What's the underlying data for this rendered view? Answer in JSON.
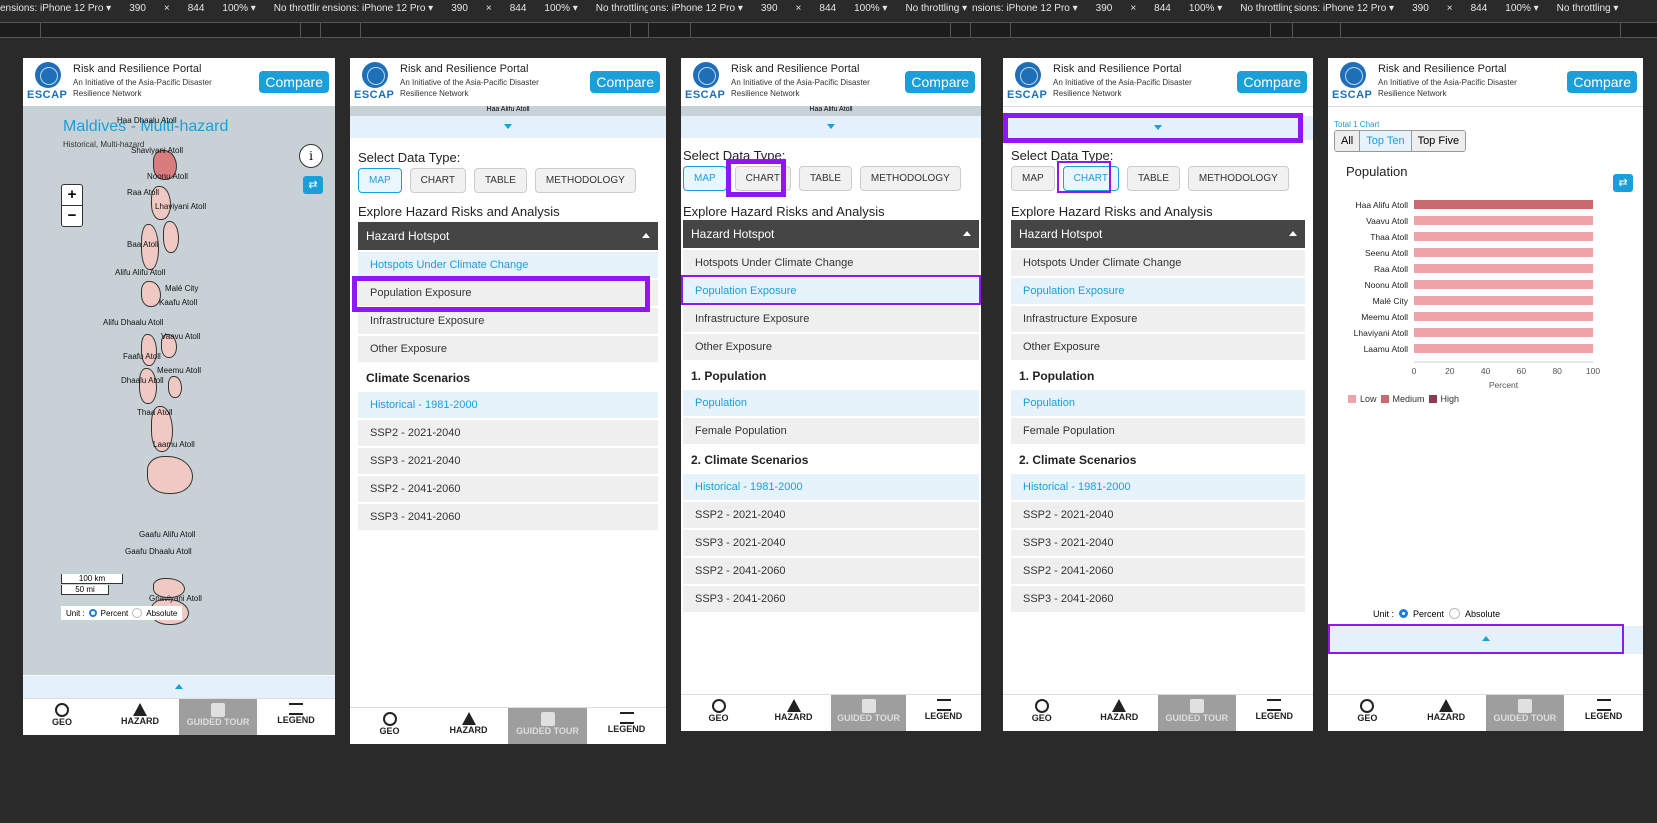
{
  "devtools": {
    "panes": [
      {
        "text": "ensions: iPhone 12 Pro ▾",
        "w": "390",
        "x": "×",
        "h": "844",
        "zoom": "100% ▾",
        "throttle": "No throttling ▾"
      },
      {
        "text": "ensions: iPhone 12 Pro ▾",
        "w": "390",
        "x": "×",
        "h": "844",
        "zoom": "100% ▾",
        "throttle": "No throttling ▾"
      },
      {
        "text": "ons: iPhone 12 Pro ▾",
        "w": "390",
        "x": "×",
        "h": "844",
        "zoom": "100% ▾",
        "throttle": "No throttling ▾"
      },
      {
        "text": "nsions: iPhone 12 Pro ▾",
        "w": "390",
        "x": "×",
        "h": "844",
        "zoom": "100% ▾",
        "throttle": "No throttling ▾"
      },
      {
        "text": "sions: iPhone 12 Pro ▾",
        "w": "390",
        "x": "×",
        "h": "844",
        "zoom": "100% ▾",
        "throttle": "No throttling ▾"
      }
    ]
  },
  "header": {
    "title": "Risk and Resilience Portal",
    "subtitle": "An Initiative of the Asia-Pacific Disaster Resilience Network",
    "logo_text": "ESCAP",
    "compare": "Compare"
  },
  "nav": {
    "geo": "GEO",
    "hazard": "HAZARD",
    "tour": "GUIDED TOUR",
    "legend": "LEGEND"
  },
  "map_screen": {
    "title": "Maldives - Multi-hazard",
    "subtitle": "Historical, Multi-hazard",
    "zoom_in": "+",
    "zoom_out": "−",
    "info": "i",
    "scale_km": "100 km",
    "scale_mi": "50 mi",
    "unit_label": "Unit :",
    "unit_percent": "Percent",
    "unit_absolute": "Absolute",
    "labels": [
      "Haa Alifu Atoll",
      "Haa Dhaalu Atoll",
      "Shaviyani Atoll",
      "Noonu Atoll",
      "Raa Atoll",
      "Lhaviyani Atoll",
      "Baa Atoll",
      "Alifu Alifu Atoll",
      "Malé City",
      "Kaafu Atoll",
      "Alifu Dhaalu Atoll",
      "Vaavu Atoll",
      "Faafu Atoll",
      "Meemu Atoll",
      "Dhaalu Atoll",
      "Thaa Atoll",
      "Laamu Atoll",
      "Gaafu Alifu Atoll",
      "Gaafu Dhaalu Atoll",
      "Gnaviyani Atoll"
    ],
    "peek_top": "Haa Alifu Atoll"
  },
  "panel": {
    "select_data_type": "Select Data Type:",
    "types": [
      "MAP",
      "CHART",
      "TABLE",
      "METHODOLOGY"
    ],
    "explore": "Explore Hazard Risks and Analysis",
    "hotspot": "Hazard Hotspot",
    "hotspots": [
      "Hotspots Under Climate Change",
      "Population Exposure",
      "Infrastructure Exposure",
      "Other Exposure"
    ],
    "climate_h": "Climate Scenarios",
    "climate_h_num": "2. Climate Scenarios",
    "population_h": "1. Population",
    "population_items": [
      "Population",
      "Female Population"
    ],
    "scenarios": [
      "Historical - 1981-2000",
      "SSP2 - 2021-2040",
      "SSP3 - 2021-2040",
      "SSP2 - 2041-2060",
      "SSP3 - 2041-2060"
    ]
  },
  "chart_screen": {
    "total_label": "Total 1 Chart",
    "filters": [
      "All",
      "Top Ten",
      "Top Five"
    ],
    "unit_label": "Unit :",
    "unit_percent": "Percent",
    "unit_absolute": "Absolute"
  },
  "chart_data": {
    "type": "bar",
    "title": "Population",
    "orientation": "horizontal",
    "stacked": true,
    "categories": [
      "Haa Alifu Atoll",
      "Vaavu Atoll",
      "Thaa Atoll",
      "Seenu Atoll",
      "Raa Atoll",
      "Noonu Atoll",
      "Malé City",
      "Meemu Atoll",
      "Lhaviyani Atoll",
      "Laamu Atoll"
    ],
    "series": [
      {
        "name": "Low",
        "color": "#f0a3a6",
        "values": [
          0,
          100,
          100,
          100,
          100,
          100,
          100,
          100,
          100,
          100
        ]
      },
      {
        "name": "Medium",
        "color": "#c96a6e",
        "values": [
          100,
          0,
          0,
          0,
          0,
          0,
          0,
          0,
          0,
          0
        ]
      },
      {
        "name": "High",
        "color": "#8c3b55",
        "values": [
          0,
          0,
          0,
          0,
          0,
          0,
          0,
          0,
          0,
          0
        ]
      }
    ],
    "xlabel": "Percent",
    "xlim": [
      0,
      100
    ],
    "xticks": [
      "0",
      "20",
      "40",
      "60",
      "80",
      "100"
    ],
    "legend_position": "bottom-left",
    "grid": false
  }
}
